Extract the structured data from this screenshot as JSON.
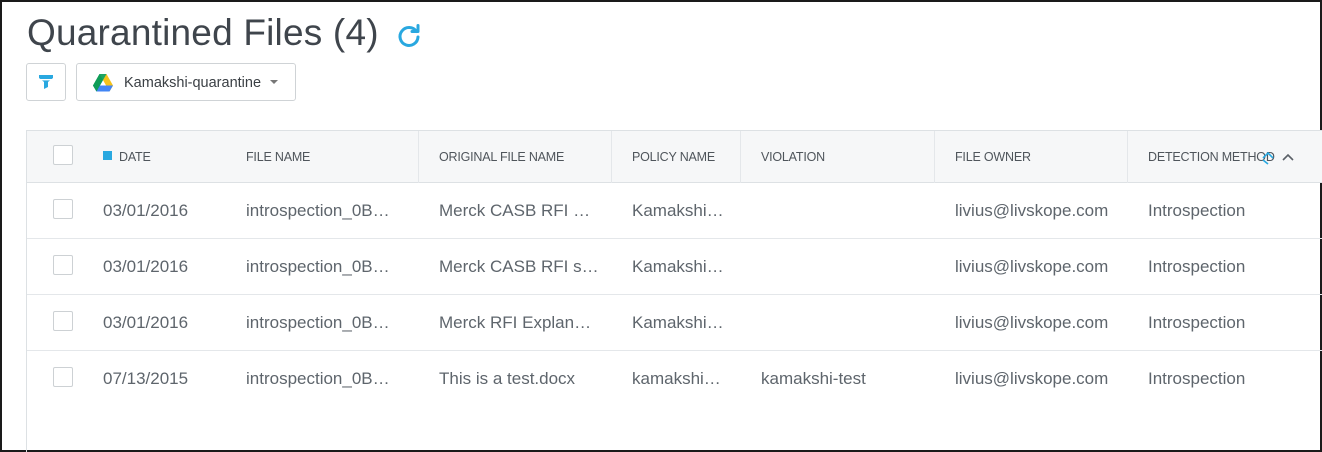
{
  "header": {
    "title": "Quarantined Files (4)",
    "refresh_icon": "refresh-icon"
  },
  "toolbar": {
    "filter_icon": "filter-icon",
    "instance_icon": "google-drive-icon",
    "instance_label": "Kamakshi-quarantine"
  },
  "table": {
    "columns": [
      "DATE",
      "FILE NAME",
      "ORIGINAL FILE NAME",
      "POLICY NAME",
      "VIOLATION",
      "FILE OWNER",
      "DETECTION METHOD"
    ],
    "rows": [
      {
        "date": "03/01/2016",
        "file_name": "introspection_0B…",
        "original_file_name": "Merck CASB RFI …",
        "policy_name": "Kamakshi…",
        "violation": "",
        "file_owner": "livius@livskope.com",
        "detection_method": "Introspection"
      },
      {
        "date": "03/01/2016",
        "file_name": "introspection_0B…",
        "original_file_name": "Merck CASB RFI s…",
        "policy_name": "Kamakshi…",
        "violation": "",
        "file_owner": "livius@livskope.com",
        "detection_method": "Introspection"
      },
      {
        "date": "03/01/2016",
        "file_name": "introspection_0B…",
        "original_file_name": "Merck RFI Explan…",
        "policy_name": "Kamakshi…",
        "violation": "",
        "file_owner": "livius@livskope.com",
        "detection_method": "Introspection"
      },
      {
        "date": "07/13/2015",
        "file_name": "introspection_0B…",
        "original_file_name": "This is a test.docx",
        "policy_name": "kamakshi…",
        "violation": "kamakshi-test",
        "file_owner": "livius@livskope.com",
        "detection_method": "Introspection"
      }
    ]
  },
  "colors": {
    "accent": "#29a8e0",
    "header_bg": "#f6f7f8",
    "border": "#dde1e4"
  }
}
